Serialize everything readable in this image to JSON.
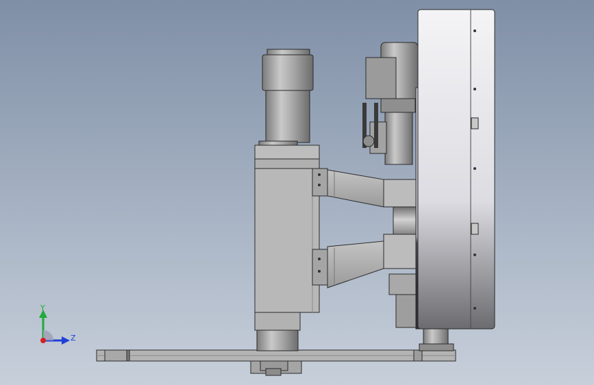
{
  "viewport": {
    "background_top": "#7f8fa6",
    "background_bottom": "#c7cfda"
  },
  "triad": {
    "y_label": "Y",
    "z_label": "Z",
    "y_color": "#1faa3a",
    "z_color": "#1f3fd8",
    "x_color": "#d81f1f"
  }
}
